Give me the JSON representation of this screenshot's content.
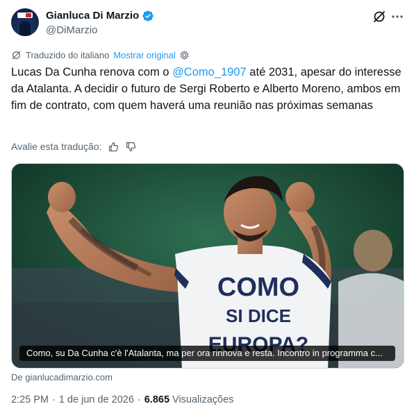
{
  "author": {
    "name": "Gianluca Di Marzio",
    "handle": "@DiMarzio",
    "verified_color": "#1d9bf0"
  },
  "translation": {
    "label": "Traduzido do italiano",
    "show_original": "Mostrar original"
  },
  "tweet": {
    "text_before": "Lucas Da Cunha renova com o ",
    "mention": "@Como_1907",
    "text_after": " até 2031, apesar do interesse da Atalanta. A decidir o futuro de Sergi Roberto e Alberto Moreno, ambos em fim de contrato, com quem haverá uma reunião nas próximas semanas"
  },
  "rating": {
    "label": "Avalie esta tradução:"
  },
  "media": {
    "caption": "Como, su Da Cunha c'è l'Atalanta, ma per ora rinnova e resta. Incontro in programma c...",
    "shirt_text_line1": "COMO",
    "shirt_text_line2": "SI DICE",
    "shirt_text_line3": "EUROPA?"
  },
  "link_source": "De gianlucadimarzio.com",
  "meta": {
    "time": "2:25 PM",
    "date": "1 de jun de 2026",
    "views_count": "6.865",
    "views_label": "Visualizações"
  },
  "icons": {
    "grok": "grok-icon",
    "more": "more-icon",
    "translate": "translate-icon",
    "settings": "settings-icon",
    "thumbs_up": "thumbs-up-icon",
    "thumbs_down": "thumbs-down-icon"
  }
}
